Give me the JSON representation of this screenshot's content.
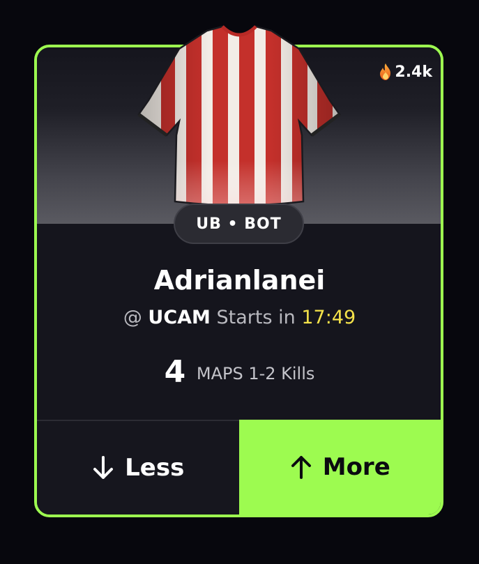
{
  "card": {
    "popularity": "2.4k",
    "position_badge": "UB • BOT",
    "player_name": "Adrianlanei",
    "team_prefix": "@",
    "team": "UCAM",
    "starts_label": "Starts in",
    "starts_time": "17:49",
    "line_value": "4",
    "stat_label": "MAPS 1-2 Kills",
    "icons": {
      "popularity": "flame-icon",
      "jersey": "jersey-icon",
      "less": "arrow-down-icon",
      "more": "arrow-up-icon"
    }
  },
  "actions": {
    "less_label": "Less",
    "more_label": "More"
  },
  "colors": {
    "accent": "#9dfb50",
    "card_bg": "#15151d",
    "time": "#f4e24a",
    "jersey_red": "#c4302b",
    "jersey_white": "#f2ece6"
  }
}
